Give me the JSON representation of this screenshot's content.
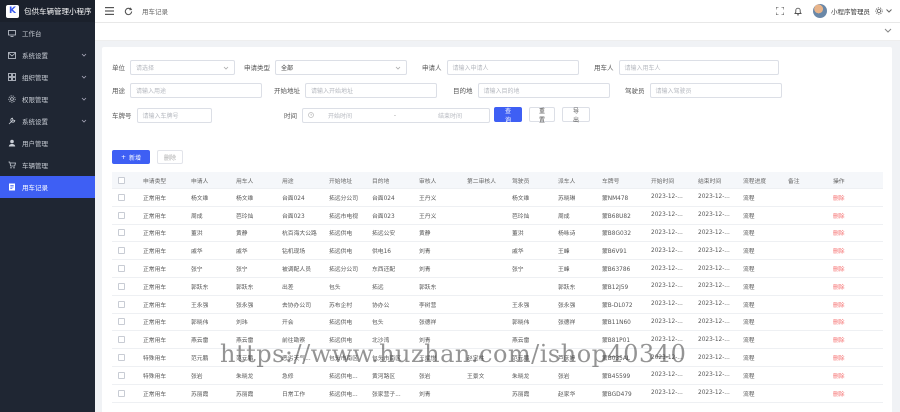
{
  "app": {
    "title": "包供车辆管理小程序",
    "logo_letter": "K"
  },
  "sidebar": {
    "items": [
      {
        "label": "工作台",
        "icon": "monitor-icon",
        "arrow": false,
        "active": false
      },
      {
        "label": "系统设置",
        "icon": "mail-icon",
        "arrow": true,
        "active": false
      },
      {
        "label": "组织管理",
        "icon": "grid-icon",
        "arrow": true,
        "active": false
      },
      {
        "label": "权限管理",
        "icon": "gear-icon",
        "arrow": true,
        "active": false
      },
      {
        "label": "系统设置",
        "icon": "tool-icon",
        "arrow": true,
        "active": false
      },
      {
        "label": "用户管理",
        "icon": "user-icon",
        "arrow": false,
        "active": false
      },
      {
        "label": "车辆管理",
        "icon": "cart-icon",
        "arrow": false,
        "active": false
      },
      {
        "label": "用车记录",
        "icon": "doc-icon",
        "arrow": false,
        "active": true
      }
    ]
  },
  "topbar": {
    "breadcrumb": "用车记录",
    "user_name": "小程序管理员"
  },
  "filters": {
    "unit_label": "单位",
    "unit_placeholder": "请选择",
    "apply_type_label": "申请类型",
    "apply_type_value": "全部",
    "applicant_label": "申请人",
    "applicant_placeholder": "请输入申请人",
    "user_label": "用车人",
    "user_placeholder": "请输入用车人",
    "purpose_label": "用途",
    "purpose_placeholder": "请输入用途",
    "start_label": "开始地址",
    "start_placeholder": "请输入开始地址",
    "dest_label": "目的地",
    "dest_placeholder": "请输入目的地",
    "driver_label": "驾驶员",
    "driver_placeholder": "请输入驾驶员",
    "plate_label": "车牌号",
    "plate_placeholder": "请输入车牌号",
    "time_label": "时间",
    "time_start_placeholder": "开始时间",
    "time_sep": "-",
    "time_end_placeholder": "结束时间",
    "search_button": "查询",
    "reset_button": "重置",
    "export_button": "导出"
  },
  "toolbar": {
    "add_button": "新增",
    "delete_button": "删除"
  },
  "table": {
    "columns": [
      "申请类型",
      "申请人",
      "用车人",
      "用途",
      "开始地址",
      "目的地",
      "审核人",
      "第二审核人",
      "驾驶员",
      "派车人",
      "车牌号",
      "开始时间",
      "结束时间",
      "流程进度",
      "备注",
      "操作"
    ],
    "rows": [
      [
        "正常用车",
        "杨文维",
        "杨文维",
        "台面024",
        "拓远分公司",
        "台面024",
        "王丹义",
        "",
        "杨文维",
        "苏晓琳",
        "蒙NM478",
        "2023-12-...",
        "2023-12-...",
        "流程",
        "",
        "删除"
      ],
      [
        "正常用车",
        "周成",
        "芭玲灿",
        "台面023",
        "拓远市电视",
        "台面023",
        "王丹义",
        "",
        "芭玲灿",
        "周成",
        "蒙B68U82",
        "2023-12-...",
        "2023-12-...",
        "流程",
        "",
        "删除"
      ],
      [
        "正常用车",
        "董洪",
        "黄静",
        "杭百海大公路",
        "拓远供电",
        "拓远公安",
        "黄静",
        "",
        "董洪",
        "杨咏诗",
        "蒙B8G032",
        "2023-12-...",
        "2023-12-...",
        "流程",
        "",
        "删除"
      ],
      [
        "正常用车",
        "戚华",
        "戚华",
        "钻机现场",
        "拓远供电",
        "供电16",
        "刘青",
        "",
        "戚华",
        "王峰",
        "蒙B6V91",
        "2023-12-...",
        "2023-12-...",
        "流程",
        "",
        "删除"
      ],
      [
        "正常用车",
        "张宁",
        "张宁",
        "被调配人员",
        "拓远分公司",
        "东西还配",
        "刘青",
        "",
        "张宁",
        "王峰",
        "蒙B63786",
        "2023-12-...",
        "2023-12-...",
        "流程",
        "",
        "删除"
      ],
      [
        "正常用车",
        "郭跃东",
        "郭跃东",
        "出差",
        "包头",
        "拓远",
        "郭跃东",
        "",
        "",
        "郭跃东",
        "蒙B12J59",
        "2023-12-...",
        "2023-12-...",
        "流程",
        "",
        "删除"
      ],
      [
        "正常用车",
        "王永强",
        "张永强",
        "去协办公司",
        "苏布企村",
        "协办公",
        "李树营",
        "",
        "王永强",
        "张永强",
        "蒙B-DL072",
        "2023-12-...",
        "2023-12-...",
        "流程",
        "",
        "删除"
      ],
      [
        "正常用车",
        "郭晓伟",
        "刘玮",
        "开会",
        "拓远供电",
        "包头",
        "张德祥",
        "",
        "郭晓伟",
        "张德祥",
        "蒙B11N60",
        "2023-12-...",
        "2023-12-...",
        "流程",
        "",
        "删除"
      ],
      [
        "正常用车",
        "燕云雷",
        "燕云雷",
        "前往勘察",
        "拓远供电",
        "北沙湾",
        "刘青",
        "",
        "燕云雷",
        "",
        "蒙B81P01",
        "2023-12-...",
        "2023-12-...",
        "流程",
        "",
        "删除"
      ],
      [
        "特殊用车",
        "范元鹏",
        "范元鹏",
        "恶劣天气...",
        "包头市南区",
        "包头市南区",
        "王斌悦",
        "赵宝柱",
        "范元鹏",
        "芦庆婷",
        "蒙B035AL",
        "2023-12-...",
        "2023-12-...",
        "流程",
        "",
        "删除"
      ],
      [
        "特殊用车",
        "张岩",
        "朱晓龙",
        "急修",
        "拓远供电...",
        "黄河路区",
        "张岩",
        "王景文",
        "朱晓龙",
        "张岩",
        "蒙B45599",
        "2023-12-...",
        "2023-12-...",
        "流程",
        "",
        "删除"
      ],
      [
        "正常用车",
        "苏丽霞",
        "苏丽霞",
        "日常工作",
        "拓远供电...",
        "张家营子...",
        "刘青",
        "",
        "苏丽霞",
        "赵家华",
        "蒙BGD479",
        "2023-12-...",
        "2023-12-...",
        "流程",
        "",
        "删除"
      ]
    ]
  },
  "watermark": "https://www.huzhan.com/ishop40340",
  "colors": {
    "accent": "#3e5ff4",
    "danger": "#f56c6c",
    "sidebar_bg": "#1f2633"
  }
}
